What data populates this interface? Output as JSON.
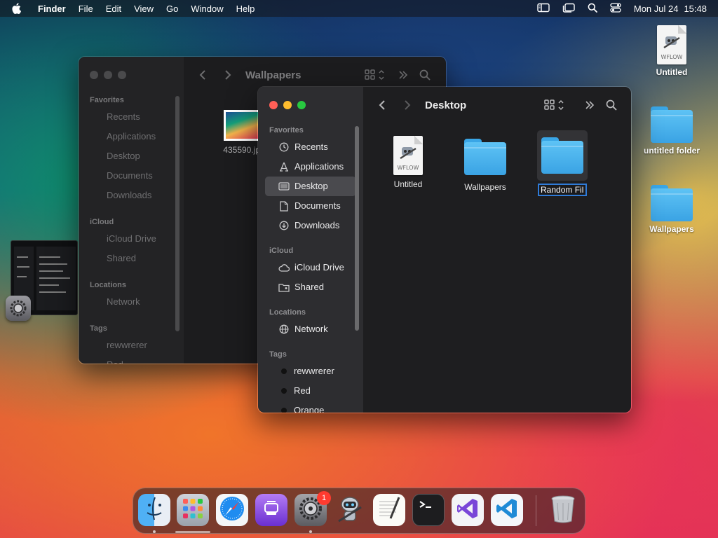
{
  "menubar": {
    "app": "Finder",
    "items": [
      "File",
      "Edit",
      "View",
      "Go",
      "Window",
      "Help"
    ],
    "date": "Mon Jul 24",
    "time": "15:48",
    "icons": [
      "control-center-icon",
      "stage-manager-icon",
      "spotlight-icon",
      "toggles-icon"
    ]
  },
  "desktop": {
    "items": [
      {
        "label": "Untitled",
        "kind": "workflow",
        "tag": "WFLOW"
      },
      {
        "label": "untitled folder",
        "kind": "folder"
      },
      {
        "label": "Wallpapers",
        "kind": "folder"
      }
    ]
  },
  "back_window": {
    "title": "Wallpapers",
    "sections": {
      "favorites": "Favorites",
      "icloud": "iCloud",
      "locations": "Locations",
      "tags": "Tags"
    },
    "favorites": [
      "Recents",
      "Applications",
      "Desktop",
      "Documents",
      "Downloads"
    ],
    "icloud": [
      "iCloud Drive",
      "Shared"
    ],
    "locations": [
      "Network"
    ],
    "tags": [
      "rewwrerer",
      "Red"
    ],
    "files": [
      {
        "label": "435590.jpg"
      }
    ]
  },
  "front_window": {
    "title": "Desktop",
    "sections": {
      "favorites": "Favorites",
      "icloud": "iCloud",
      "locations": "Locations",
      "tags": "Tags"
    },
    "favorites": [
      {
        "label": "Recents",
        "icon": "clock-icon"
      },
      {
        "label": "Applications",
        "icon": "applications-icon"
      },
      {
        "label": "Desktop",
        "icon": "desktop-icon",
        "selected": true
      },
      {
        "label": "Documents",
        "icon": "document-icon"
      },
      {
        "label": "Downloads",
        "icon": "download-icon"
      }
    ],
    "icloud": [
      {
        "label": "iCloud Drive",
        "icon": "cloud-icon"
      },
      {
        "label": "Shared",
        "icon": "shared-folder-icon"
      }
    ],
    "locations": [
      {
        "label": "Network",
        "icon": "globe-icon"
      }
    ],
    "tags": [
      {
        "label": "rewwrerer",
        "color": "#111111"
      },
      {
        "label": "Red",
        "color": "#111111"
      },
      {
        "label": "Orange",
        "color": "#111111"
      }
    ],
    "files": [
      {
        "label": "Untitled",
        "kind": "workflow",
        "tag": "WFLOW"
      },
      {
        "label": "Wallpapers",
        "kind": "folder"
      },
      {
        "label": "Random Fil",
        "kind": "folder",
        "renaming": true
      }
    ]
  },
  "dock": {
    "apps": [
      {
        "name": "Finder",
        "icon": "finder-icon",
        "running": true
      },
      {
        "name": "Launchpad",
        "icon": "launchpad-icon",
        "running": false
      },
      {
        "name": "Safari",
        "icon": "safari-icon",
        "running": false
      },
      {
        "name": "Podcasts",
        "icon": "podcasts-icon",
        "running": false
      },
      {
        "name": "System Settings",
        "icon": "settings-gear-icon",
        "running": true,
        "badge": "1"
      },
      {
        "name": "Automator",
        "icon": "automator-icon",
        "running": false
      },
      {
        "name": "TextEdit",
        "icon": "textedit-icon",
        "running": false
      },
      {
        "name": "Terminal",
        "icon": "terminal-icon",
        "running": false
      },
      {
        "name": "Visual Studio",
        "icon": "visual-studio-icon",
        "running": false
      },
      {
        "name": "VS Code",
        "icon": "vscode-icon",
        "running": false
      },
      {
        "name": "Trash",
        "icon": "trash-icon",
        "running": false
      }
    ]
  },
  "colors": {
    "accent": "#2f7bd8",
    "folder": "#4db4ee",
    "close": "#ff5f57",
    "minimize": "#febc2e",
    "zoom": "#28c840"
  }
}
